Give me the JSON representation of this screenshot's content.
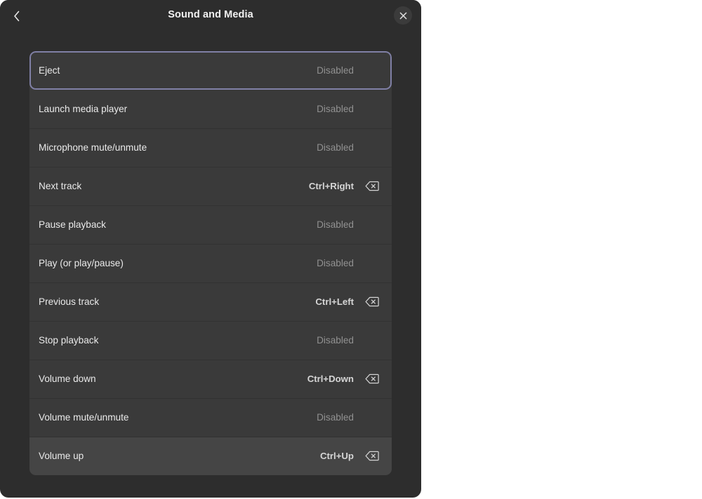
{
  "window": {
    "title": "Sound and Media",
    "back_icon": "chevron-left-icon",
    "close_icon": "close-icon"
  },
  "colors": {
    "window_bg": "#2d2d2d",
    "row_bg": "#3a3a3a",
    "row_hover_bg": "#454545",
    "focus_ring": "#8080a6",
    "label_text": "#eaeaea",
    "disabled_text": "#919191",
    "shortcut_text": "#d6d6d6",
    "page_bg": "#ffffff"
  },
  "shortcuts": {
    "disabled_label": "Disabled",
    "clear_icon": "backspace-clear-icon",
    "items": [
      {
        "name": "Eject",
        "value": "Disabled",
        "assigned": false,
        "state": "focused"
      },
      {
        "name": "Launch media player",
        "value": "Disabled",
        "assigned": false,
        "state": "normal"
      },
      {
        "name": "Microphone mute/unmute",
        "value": "Disabled",
        "assigned": false,
        "state": "normal"
      },
      {
        "name": "Next track",
        "value": "Ctrl+Right",
        "assigned": true,
        "state": "normal"
      },
      {
        "name": "Pause playback",
        "value": "Disabled",
        "assigned": false,
        "state": "normal"
      },
      {
        "name": "Play (or play/pause)",
        "value": "Disabled",
        "assigned": false,
        "state": "normal"
      },
      {
        "name": "Previous track",
        "value": "Ctrl+Left",
        "assigned": true,
        "state": "normal"
      },
      {
        "name": "Stop playback",
        "value": "Disabled",
        "assigned": false,
        "state": "normal"
      },
      {
        "name": "Volume down",
        "value": "Ctrl+Down",
        "assigned": true,
        "state": "normal"
      },
      {
        "name": "Volume mute/unmute",
        "value": "Disabled",
        "assigned": false,
        "state": "normal"
      },
      {
        "name": "Volume up",
        "value": "Ctrl+Up",
        "assigned": true,
        "state": "hovered"
      }
    ]
  }
}
